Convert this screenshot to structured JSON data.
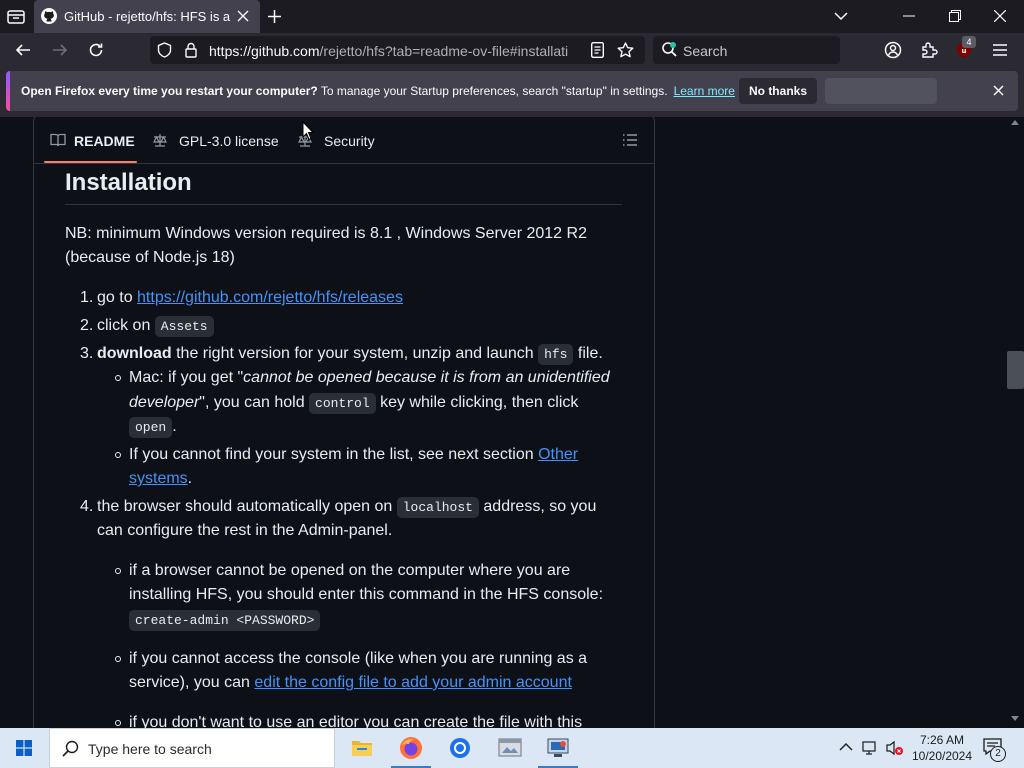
{
  "browser": {
    "tab_title": "GitHub - rejetto/hfs: HFS is a we",
    "url_host": "https://github.com",
    "url_rest": "/rejetto/hfs?tab=readme-ov-file#installati",
    "search_placeholder": "Search",
    "extension_badge": "4"
  },
  "notification": {
    "bold_text": "Open Firefox every time you restart your computer?",
    "text": " To manage your Startup preferences, search \"startup\" in settings.",
    "link": "Learn more",
    "no_thanks": "No thanks"
  },
  "readme_tabs": [
    "README",
    "GPL-3.0 license",
    "Security"
  ],
  "content": {
    "heading": "Installation",
    "nb_line1": "NB: minimum Windows version required is 8.1 , Windows Server 2012 R2",
    "nb_line2": "(because of Node.js 18)",
    "step1_prefix": "go to ",
    "step1_link": "https://github.com/rejetto/hfs/releases",
    "step2_prefix": "click on ",
    "step2_code": "Assets",
    "step3_bold": "download",
    "step3_text": " the right version for your system, unzip and launch ",
    "step3_code": "hfs",
    "step3_suffix": " file.",
    "mac_l1_prefix": "Mac: if you get \"",
    "mac_l1_italic": "cannot be opened because it is from an unidentified",
    "mac_l2_italic": "developer",
    "mac_l2_text": "\", you can hold ",
    "mac_l2_code": "control",
    "mac_l2_suffix": " key while clicking, then click",
    "mac_l3_code": "open",
    "mac_l3_suffix": ".",
    "other_l1_text": "If you cannot find your system in the list, see next section ",
    "other_l1_link": "Other",
    "other_l2_link": "systems",
    "other_l2_suffix": ".",
    "step4_l1_text": "the browser should automatically open on ",
    "step4_l1_code": "localhost",
    "step4_l1_suffix": " address, so you",
    "step4_l2": "can configure the rest in the Admin-panel.",
    "b1_l1": "if a browser cannot be opened on the computer where you are",
    "b1_l2": "installing HFS, you should enter this command in the HFS console:",
    "b1_code": "create-admin <PASSWORD>",
    "b2_l1": "if you cannot access the console (like when you are running as a",
    "b2_l2_prefix": "service), you can ",
    "b2_l2_link": "edit the config file to add your admin account",
    "b3_l1": "if you don't want to use an editor you can create the file with this"
  },
  "taskbar": {
    "search_placeholder": "Type here to search",
    "time": "7:26 AM",
    "date": "10/20/2024",
    "notification_count": "2"
  }
}
